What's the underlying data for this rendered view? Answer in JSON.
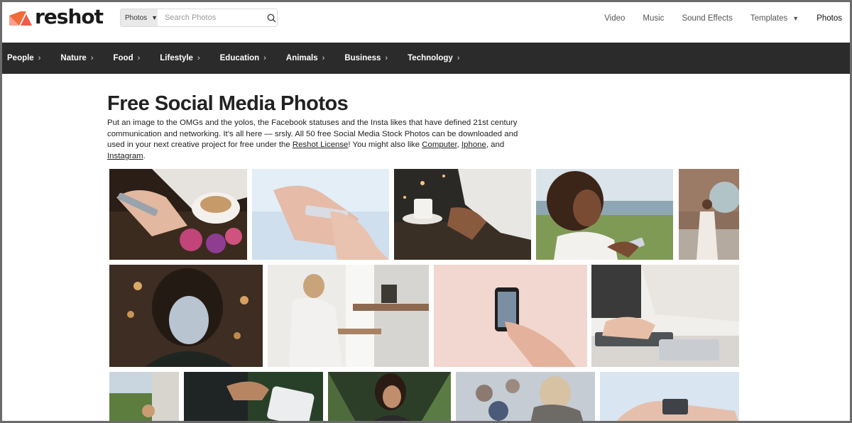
{
  "header": {
    "logo_text": "reshot",
    "search": {
      "type_label": "Photos",
      "placeholder": "Search Photos",
      "value": ""
    },
    "nav": [
      {
        "label": "Video"
      },
      {
        "label": "Music"
      },
      {
        "label": "Sound Effects"
      },
      {
        "label": "Templates"
      },
      {
        "label": "Photos"
      }
    ]
  },
  "categories": [
    {
      "label": "People"
    },
    {
      "label": "Nature"
    },
    {
      "label": "Food"
    },
    {
      "label": "Lifestyle"
    },
    {
      "label": "Education"
    },
    {
      "label": "Animals"
    },
    {
      "label": "Business"
    },
    {
      "label": "Technology"
    }
  ],
  "main": {
    "title": "Free Social Media Photos",
    "description": {
      "text_1": "Put an image to the OMGs and the yolos, the Facebook statuses and the Insta likes that have defined 21st century communication and networking. It’s all here — srsly. All 50 free Social Media Stock Photos can be downloaded and used in your next creative project for free under the ",
      "license_link": "Reshot License",
      "text_2": "! You might also like ",
      "link_1": "Computer",
      "sep_1": ", ",
      "link_2": "Iphone",
      "sep_2": ", and ",
      "link_3": "Instagram",
      "text_3": "."
    }
  },
  "colors": {
    "catbar_bg": "#2b2b2b",
    "logo_orange": "#f26b3a",
    "logo_pink": "#f8a08f"
  }
}
